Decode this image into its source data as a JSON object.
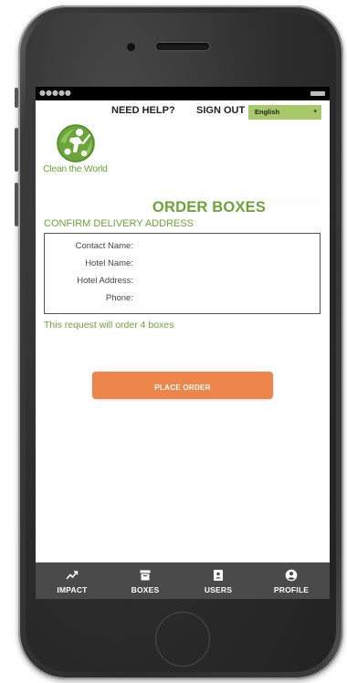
{
  "status_bar": {
    "signal": "●●●●●"
  },
  "header": {
    "help_label": "NEED HELP?",
    "signout_label": "SIGN OUT",
    "language": {
      "selected": "English",
      "icon": "chevron-down-icon"
    }
  },
  "logo": {
    "name": "Clean the World",
    "icon": "clean-the-world-logo"
  },
  "page": {
    "title": "ORDER BOXES",
    "subtitle": "CONFIRM DELIVERY ADDRESS"
  },
  "address": {
    "fields": [
      {
        "label": "Contact Name:",
        "value": ""
      },
      {
        "label": "Hotel Name:",
        "value": ""
      },
      {
        "label": "Hotel Address:",
        "value": ""
      },
      {
        "label": "Phone:",
        "value": ""
      }
    ]
  },
  "note": "This request will order 4 boxes",
  "actions": {
    "place_order_label": "PLACE ORDER"
  },
  "tabbar": {
    "items": [
      {
        "label": "IMPACT",
        "icon": "trending-up-icon"
      },
      {
        "label": "BOXES",
        "icon": "archive-box-icon"
      },
      {
        "label": "USERS",
        "icon": "contact-card-icon"
      },
      {
        "label": "PROFILE",
        "icon": "account-circle-icon"
      }
    ]
  },
  "colors": {
    "brand_green": "#6aa53a",
    "language_green": "#a8c96a",
    "button_orange": "#ee854a",
    "tabbar_bg": "#4a4a4a"
  }
}
